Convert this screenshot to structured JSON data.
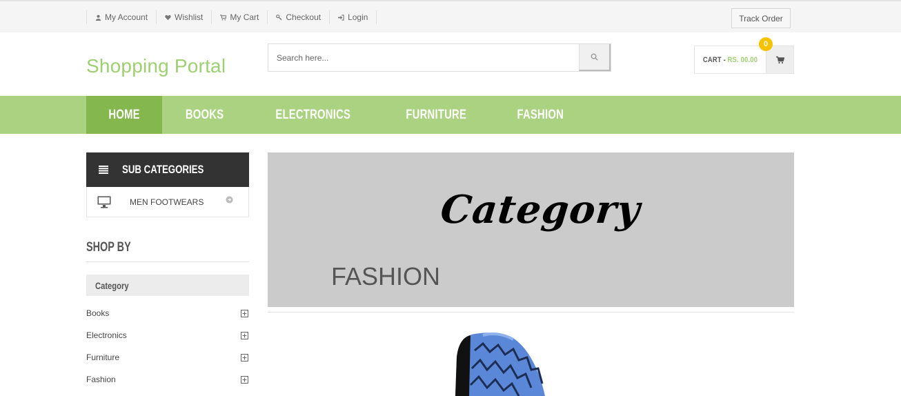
{
  "topbar": {
    "links": [
      {
        "label": "My Account",
        "icon": "user-icon"
      },
      {
        "label": "Wishlist",
        "icon": "heart-icon"
      },
      {
        "label": "My Cart",
        "icon": "cart-icon"
      },
      {
        "label": "Checkout",
        "icon": "key-icon"
      },
      {
        "label": "Login",
        "icon": "login-icon"
      }
    ],
    "track_order": "Track Order"
  },
  "header": {
    "logo": "Shopping Portal",
    "search_placeholder": "Search here...",
    "cart_label": "CART -",
    "cart_amount": "RS. 00.00",
    "cart_count": "0"
  },
  "nav": {
    "items": [
      "HOME",
      "BOOKS",
      "ELECTRONICS",
      "FURNITURE",
      "FASHION"
    ],
    "active": "HOME"
  },
  "sidebar": {
    "subcategories_title": "SUB CATEGORIES",
    "subcategories": [
      "MEN FOOTWEARS"
    ],
    "shop_by_title": "SHOP BY",
    "category_title": "Category",
    "categories": [
      "Books",
      "Electronics",
      "Furniture",
      "Fashion"
    ]
  },
  "main": {
    "banner_script": "Category",
    "banner_title": "FASHION"
  },
  "colors": {
    "accent_green": "#abd280",
    "active_green": "#84b84e",
    "logo_green": "#9fcf73",
    "badge_yellow": "#f5c300"
  }
}
